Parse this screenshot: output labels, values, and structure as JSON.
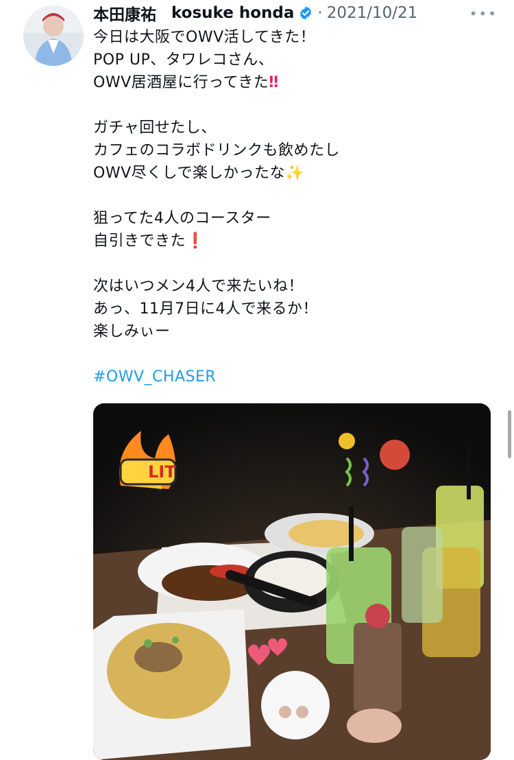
{
  "tweet": {
    "display_name": "本田康祐",
    "handle": "kosuke honda",
    "separator": "·",
    "date": "2021/10/21",
    "more_icon": "•••",
    "lines": [
      "今日は大阪でOWV活してきた！",
      "POP UP、タワレコさん、",
      "OWV居酒屋に行ってきた",
      "",
      "ガチャ回せたし、",
      "カフェのコラボドリンクも飲めたし",
      "OWV尽くしで楽しかったな",
      "",
      "狙ってた4人のコースター",
      "自引きできた",
      "",
      "次はいつメン4人で来たいね！",
      "あっ、11月7日に4人で来るか！",
      "楽しみぃー",
      ""
    ],
    "emoji": {
      "double_exclamation": "‼",
      "sparkles": "✨",
      "exclamation": "❗"
    },
    "hashtag": "#OWV_CHASER",
    "photo": {
      "stickers": {
        "lit": "LIT"
      }
    }
  },
  "colors": {
    "link": "#1d9bf0",
    "verified": "#1d9bf0",
    "muted": "#536471"
  },
  "icons": [
    "avatar-image",
    "verified-badge-icon",
    "more-icon",
    "double-exclamation-emoji",
    "sparkles-emoji",
    "exclamation-emoji",
    "fire-sticker",
    "party-popper-sticker",
    "hearts-sticker"
  ]
}
